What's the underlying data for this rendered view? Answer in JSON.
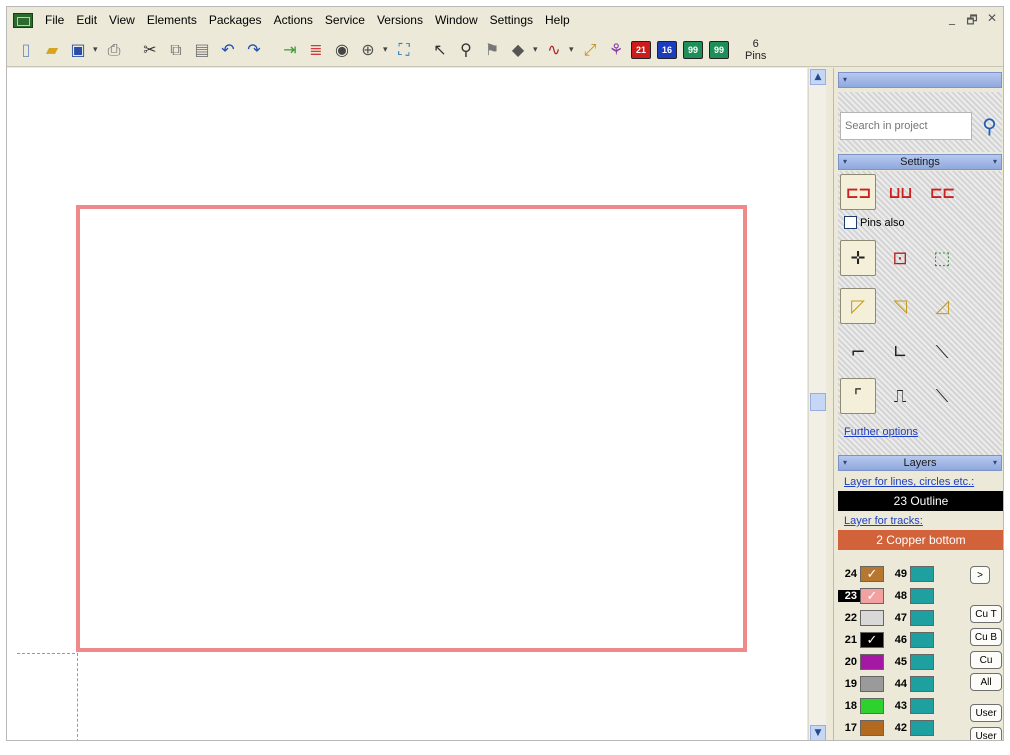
{
  "menu": [
    "File",
    "Edit",
    "View",
    "Elements",
    "Packages",
    "Actions",
    "Service",
    "Versions",
    "Window",
    "Settings",
    "Help"
  ],
  "window_controls": [
    "_",
    "🗗",
    "✕"
  ],
  "toolbar": {
    "badge_red": "21",
    "badge_blue": "16",
    "badge_green1": "99",
    "badge_green2": "99",
    "pins_count": "6",
    "pins_label": "Pins"
  },
  "search": {
    "placeholder": "Search in project"
  },
  "panel": {
    "settings_title": "Settings",
    "pins_also": "Pins also",
    "further_options": "Further options",
    "layers_title": "Layers",
    "lines_label": "Layer for lines, circles etc.:",
    "lines_value": "23 Outline",
    "tracks_label": "Layer for tracks:",
    "tracks_value": "2 Copper bottom"
  },
  "colors": {
    "board_outline": "#f08a8a",
    "outline_bar": "#000000",
    "copper_bar": "#d2623a"
  },
  "layers_left": [
    {
      "num": "24",
      "color": "#b8772e",
      "mark": "✓"
    },
    {
      "num": "23",
      "color": "#f2a0a0",
      "mark": "✓",
      "selected": true
    },
    {
      "num": "22",
      "color": "#d8d8d8",
      "mark": ""
    },
    {
      "num": "21",
      "color": "#000000",
      "mark": "✓"
    },
    {
      "num": "20",
      "color": "#a418a4",
      "mark": ""
    },
    {
      "num": "19",
      "color": "#9a9a9a",
      "mark": ""
    },
    {
      "num": "18",
      "color": "#2ed22e",
      "mark": ""
    },
    {
      "num": "17",
      "color": "#b46a1e",
      "mark": ""
    }
  ],
  "layers_right": [
    "49",
    "48",
    "47",
    "46",
    "45",
    "44",
    "43",
    "42"
  ],
  "layer_buttons": {
    "expand": ">",
    "cu_top": "Cu T",
    "cu_bottom": "Cu B",
    "cu": "Cu",
    "all": "All",
    "user1": "User",
    "user2": "User"
  }
}
